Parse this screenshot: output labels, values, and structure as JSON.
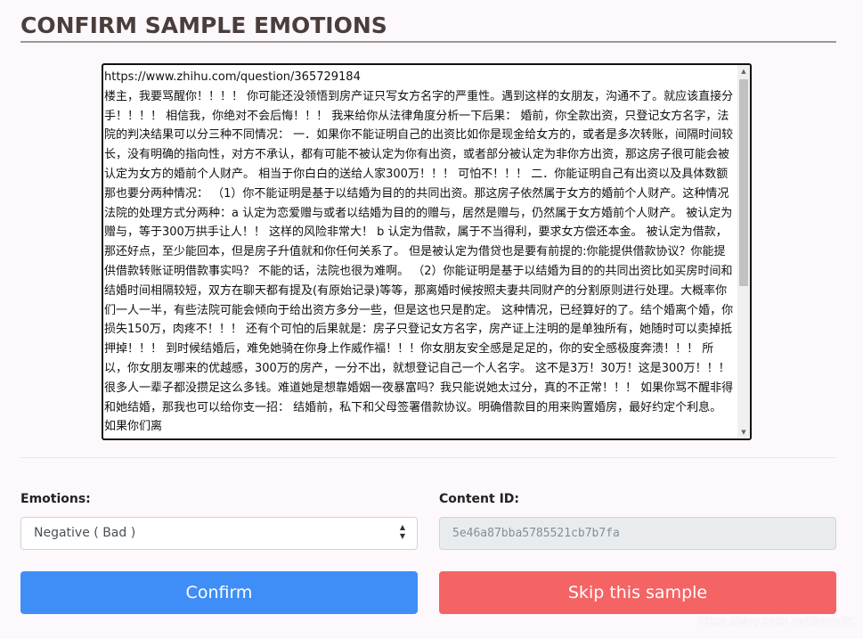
{
  "page": {
    "title": "CONFIRM SAMPLE EMOTIONS"
  },
  "sample": {
    "text": "https://www.zhihu.com/question/365729184\n楼主，我要骂醒你！！！！ 你可能还没领悟到房产证只写女方名字的严重性。遇到这样的女朋友，沟通不了。就应该直接分手！！！！ 相信我，你绝对不会后悔！！！ 我来给你从法律角度分析一下后果： 婚前，你全款出资，只登记女方名字，法院的判决结果可以分三种不同情况： 一．如果你不能证明自己的出资比如你是现金给女方的，或者是多次转账，间隔时间较长，没有明确的指向性，对方不承认，都有可能不被认定为你有出资，或者部分被认定为非你方出资，那这房子很可能会被认定为女方的婚前个人财产。 相当于你白白的送给人家300万！！！ 可怕不！！！ 二．你能证明自己有出资以及具体数额 那也要分两种情况： （1）你不能证明是基于以结婚为目的的共同出资。那这房子依然属于女方的婚前个人财产。这种情况法院的处理方式分两种：a 认定为恋爱赠与或者以结婚为目的的赠与，居然是赠与，仍然属于女方婚前个人财产。 被认定为赠与，等于300万拱手让人！！ 这样的风险非常大！ b 认定为借款，属于不当得利，要求女方偿还本金。 被认定为借款，那还好点，至少能回本，但是房子升值就和你任何关系了。 但是被认定为借贷也是要有前提的:你能提供借款协议？你能提供借款转账证明借款事实吗？ 不能的话，法院也很为难啊。 （2）你能证明是基于以结婚为目的的共同出资比如买房时间和结婚时间相隔较短，双方在聊天都有提及(有原始记录)等等，那离婚时候按照夫妻共同财产的分割原则进行处理。大概率你们一人一半，有些法院可能会倾向于给出资方多分一些，但是这也只是酌定。 这种情况，已经算好的了。结个婚离个婚，你损失150万，肉疼不！！！ 还有个可怕的后果就是：房子只登记女方名字，房产证上注明的是单独所有，她随时可以卖掉抵押掉！！！ 到时候结婚后，难免她骑在你身上作威作福！！！你女朋友安全感是足足的，你的安全感极度奔溃！！！ 所以，你女朋友哪来的优越感，300万的房产，一分不出，就想登记自己一个人名字。 这不是3万！30万！这是300万！！！ 很多人一辈子都没攒足这么多钱。难道她是想靠婚姻一夜暴富吗？我只能说她太过分，真的不正常！！！ 如果你骂不醒非得和她结婚，那我也可以给你支一招： 结婚前，私下和父母签署借款协议。明确借款目的用来购置婚房，最好约定个利息。 如果你们离"
  },
  "form": {
    "emotions_label": "Emotions:",
    "emotions_selected": "Negative ( Bad )",
    "content_id_label": "Content ID:",
    "content_id_value": "5e46a87bba5785521cb7b7fa"
  },
  "buttons": {
    "confirm_label": "Confirm",
    "skip_label": "Skip this sample"
  },
  "watermark": "https://blog.csdn.net/BerryBC",
  "colors": {
    "confirm": "#3f8ef7",
    "skip": "#f46465",
    "title": "#4a3e3c",
    "background": "#fdf8fc"
  }
}
